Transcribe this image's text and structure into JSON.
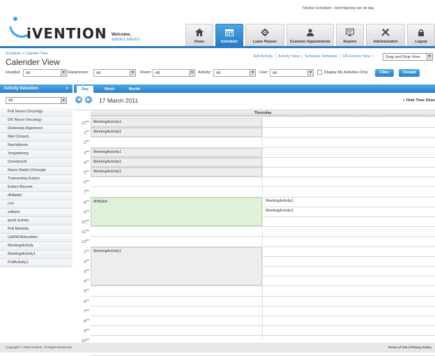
{
  "top_note": "iVention Scheduler - berichtgeving van de dag",
  "logo_text": "iVENTION",
  "welcome_label": "Welcome,",
  "welcome_user": "admin1 admin1",
  "nav": [
    "Home",
    "Scheduler",
    "Leave Planner",
    "Customer Appointments",
    "Reports",
    "Administration",
    "Logout"
  ],
  "breadcrumb": "Scheduler > Calender View",
  "page_title": "Calender View",
  "actions": [
    "Add Activity",
    "Activity View",
    "Schedule Template",
    "OR Activity View"
  ],
  "view_select": "Drag and Drop View",
  "filters": {
    "hospital_label": "Hospital:",
    "hospital_value": "All",
    "department_label": "Department:",
    "department_value": "All",
    "room_label": "Room:",
    "room_value": "All",
    "activity_label": "Activity:",
    "activity_value": "All",
    "user_label": "User:",
    "user_value": "All",
    "my_activities_label": "Display My Activities Only",
    "filter_btn": "Filter",
    "viewall_btn": "Viewall"
  },
  "sidebar": {
    "title": "Activity Selection",
    "collapse": "«",
    "select_value": "All",
    "items": [
      "Poli Neuro Oncology",
      "OK Neuro Oncology",
      "Onderwijs Algemeen",
      "Niet Clinisch",
      "Nachtdients",
      "Vergadering",
      "Overdracht",
      "Neuro Radio Chirurgie",
      "Traineeship Extern",
      "Extern Bezoek",
      "dfdfadaf",
      "rrrrr",
      "zallarts",
      "good activity",
      "Poli Mariette",
      "UsKNOEducation",
      "MeetingActivity",
      "MeetingActivity1",
      "PoliActivity1"
    ]
  },
  "main": {
    "tabs": [
      "Day",
      "Week",
      "Month"
    ],
    "prev_btn": "◀",
    "next_btn": "▶",
    "date": "17 March 2011",
    "hide_label": "Hide Time Slots",
    "hide_icon": "+",
    "calendar": {
      "day_header": "Thursday",
      "hours": [
        "12",
        "1",
        "2",
        "3",
        "4",
        "5",
        "6",
        "7",
        "8",
        "9",
        "10",
        "11",
        "12",
        "1",
        "2",
        "3",
        "4",
        "5",
        "6",
        "7",
        "8",
        "9",
        "10",
        "11"
      ],
      "am": "am",
      "pm": "pm",
      "events": {
        "ev1": "MeetingActivity1",
        "ev2": "MeetingActivity1",
        "ev3": "MeetingActivity1",
        "ev4": "MeetingActivity1",
        "ev5": "MeetingActivity1",
        "green": "dfdfadaf",
        "right1": "MeetingActivity1",
        "right2": "MeetingActivity1",
        "pm1": "MeetingActivity1"
      }
    }
  },
  "footer": {
    "copyright": "Copyright © 2009 iVention. All Rights Reserved.",
    "links": "Terms of Use | Privacy Policy"
  }
}
